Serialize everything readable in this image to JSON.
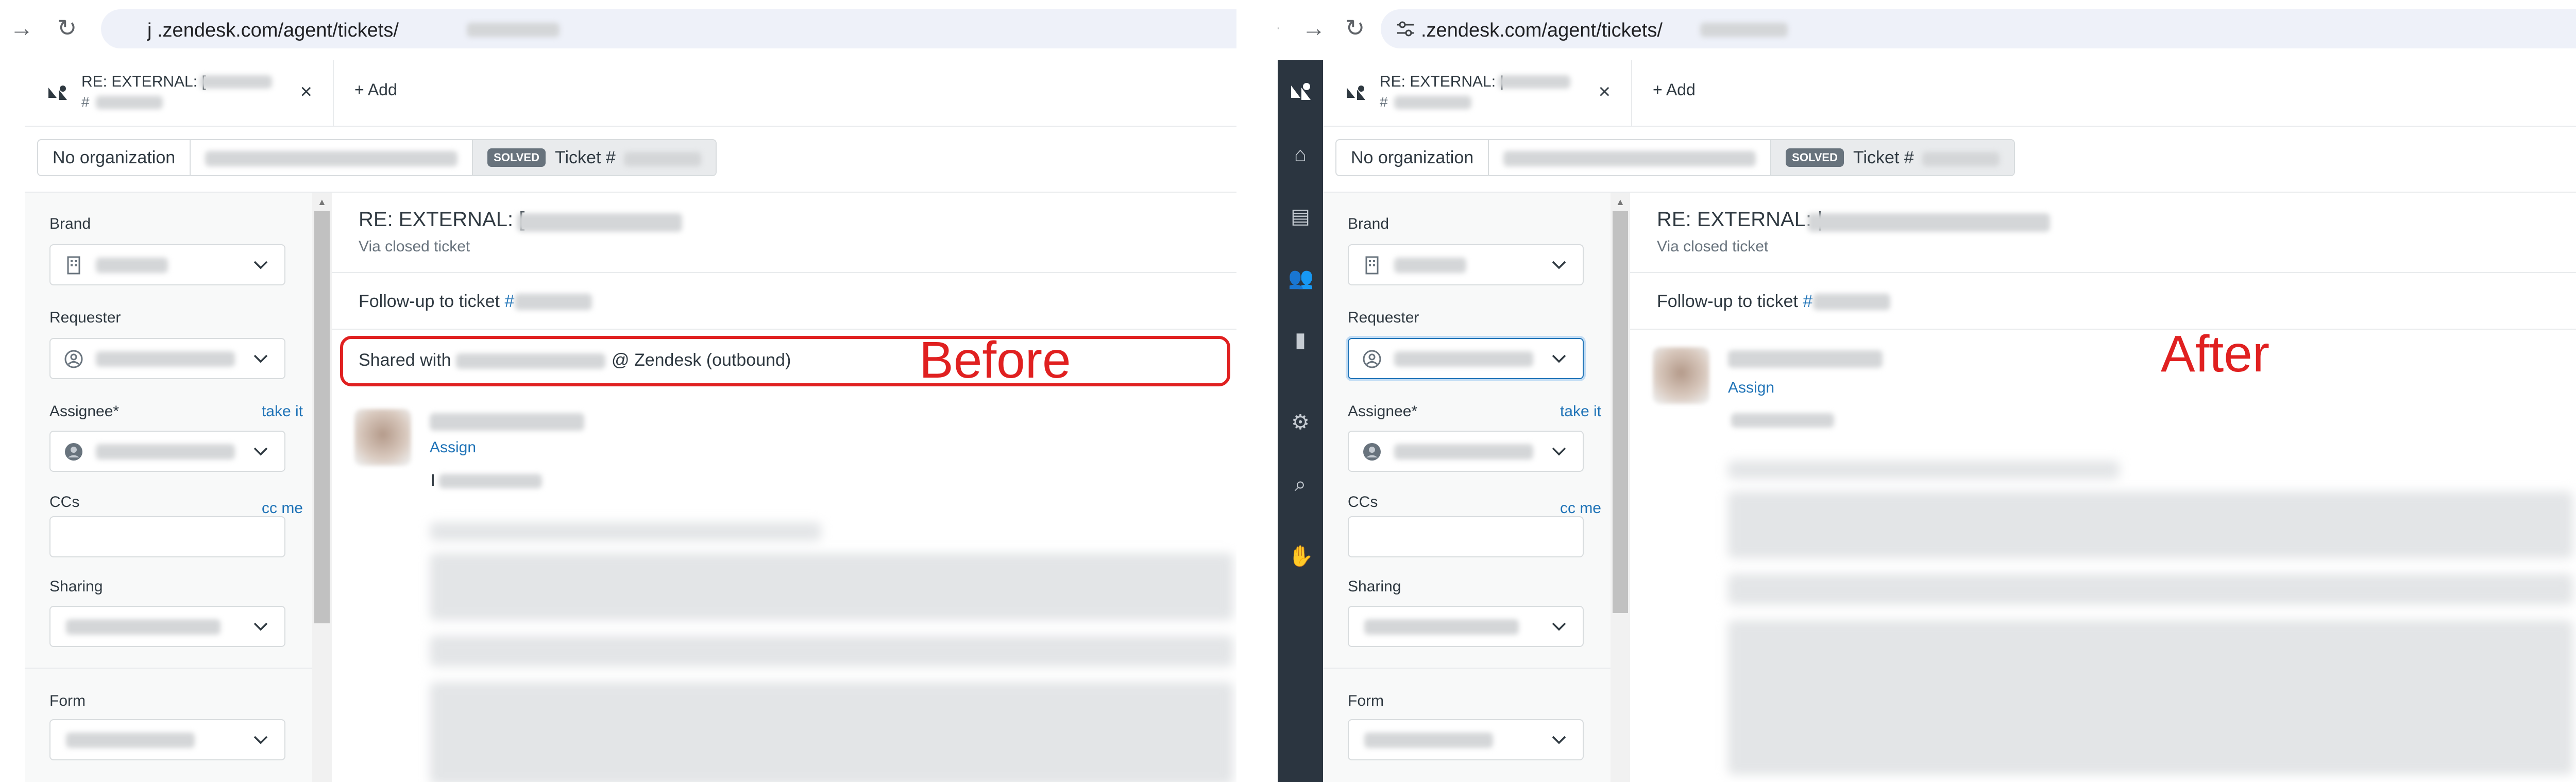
{
  "before": {
    "url": "j  .zendesk.com/agent/tickets/",
    "tab": {
      "title": "RE: EXTERNAL: [",
      "subtitle": "#",
      "close": "×",
      "add_label": "+ Add"
    },
    "org_bar": {
      "organization": "No organization",
      "status": "SOLVED",
      "ticket": "Ticket #"
    },
    "sidebar": {
      "brand_label": "Brand",
      "requester_label": "Requester",
      "assignee_label": "Assignee*",
      "take_it": "take it",
      "ccs_label": "CCs",
      "cc_me": "cc me",
      "sharing_label": "Sharing",
      "form_label": "Form"
    },
    "main": {
      "subject": "RE: EXTERNAL: [",
      "via": "Via closed ticket",
      "followup_prefix": "Follow-up to ticket ",
      "followup_link": "#",
      "shared_prefix": "Shared with ",
      "shared_suffix": "@ Zendesk (outbound)",
      "assign": "Assign",
      "body_start": "I"
    },
    "annotation": "Before"
  },
  "after": {
    "url": ".zendesk.com/agent/tickets/",
    "tab": {
      "title": "RE: EXTERNAL: |",
      "subtitle": "#",
      "close": "×",
      "add_label": "+ Add"
    },
    "org_bar": {
      "organization": "No organization",
      "status": "SOLVED",
      "ticket": "Ticket #"
    },
    "sidebar": {
      "brand_label": "Brand",
      "requester_label": "Requester",
      "assignee_label": "Assignee*",
      "take_it": "take it",
      "ccs_label": "CCs",
      "cc_me": "cc me",
      "sharing_label": "Sharing",
      "form_label": "Form"
    },
    "main": {
      "subject": "RE: EXTERNAL: |",
      "via": "Via closed ticket",
      "followup_prefix": "Follow-up to ticket ",
      "followup_link": "#",
      "assign": "Assign"
    },
    "annotation": "After"
  },
  "colors": {
    "accent": "#1f73b7",
    "annotation": "#e02020",
    "nav_dark": "#2b3540",
    "badge": "#68737d"
  },
  "icons": [
    "back-arrow-icon",
    "forward-arrow-icon",
    "reload-icon",
    "site-settings-icon",
    "zendesk-logo-icon",
    "close-icon",
    "plus-icon",
    "building-icon",
    "user-circle-icon",
    "assignee-avatar-icon",
    "chevron-down-icon",
    "home-icon",
    "views-icon",
    "customers-icon",
    "reporting-icon",
    "admin-gear-icon",
    "search-icon",
    "handshake-icon"
  ]
}
